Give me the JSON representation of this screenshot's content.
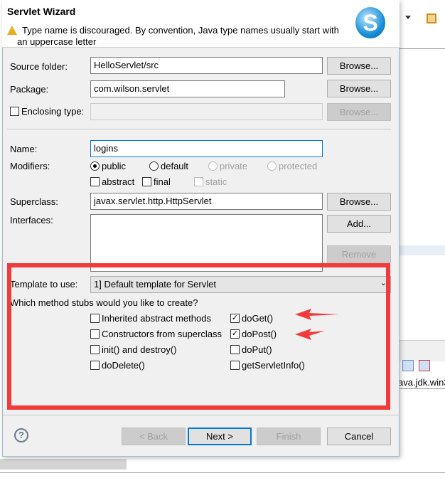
{
  "dialog": {
    "title": "Servlet Wizard",
    "warning": "Type name is discouraged. By convention, Java type names usually start with",
    "warning_line2": "an uppercase letter"
  },
  "form": {
    "source_folder": {
      "label": "Source folder:",
      "value": "HelloServlet/src",
      "browse": "Browse..."
    },
    "package": {
      "label": "Package:",
      "value": "com.wilson.servlet",
      "browse": "Browse..."
    },
    "enclosing": {
      "label": "Enclosing type:",
      "value": "",
      "browse": "Browse...",
      "checked": false
    },
    "name": {
      "label": "Name:",
      "value": "logins"
    },
    "modifiers": {
      "label": "Modifiers:",
      "public": "public",
      "default": "default",
      "private": "private",
      "protected": "protected",
      "abstract": "abstract",
      "final": "final",
      "static": "static",
      "selected": "public"
    },
    "superclass": {
      "label": "Superclass:",
      "value": "javax.servlet.http.HttpServlet",
      "browse": "Browse..."
    },
    "interfaces": {
      "label": "Interfaces:",
      "add": "Add...",
      "remove": "Remove"
    },
    "template": {
      "label": "Template to use:",
      "value": "1] Default template for Servlet"
    },
    "stubs": {
      "question": "Which method stubs would you like to create?",
      "items": [
        {
          "label": "Inherited abstract methods",
          "checked": false
        },
        {
          "label": "doGet()",
          "checked": true
        },
        {
          "label": "Constructors from superclass",
          "checked": false
        },
        {
          "label": "doPost()",
          "checked": true
        },
        {
          "label": "init() and destroy()",
          "checked": false
        },
        {
          "label": "doPut()",
          "checked": false
        },
        {
          "label": "doDelete()",
          "checked": false
        },
        {
          "label": "getServletInfo()",
          "checked": false
        }
      ]
    }
  },
  "footer": {
    "back": "< Back",
    "next": "Next >",
    "finish": "Finish",
    "cancel": "Cancel"
  },
  "background": {
    "console_text": "ava.jdk.win3"
  },
  "colors": {
    "annotation": "#f23a3a",
    "focus": "#0078d7"
  }
}
